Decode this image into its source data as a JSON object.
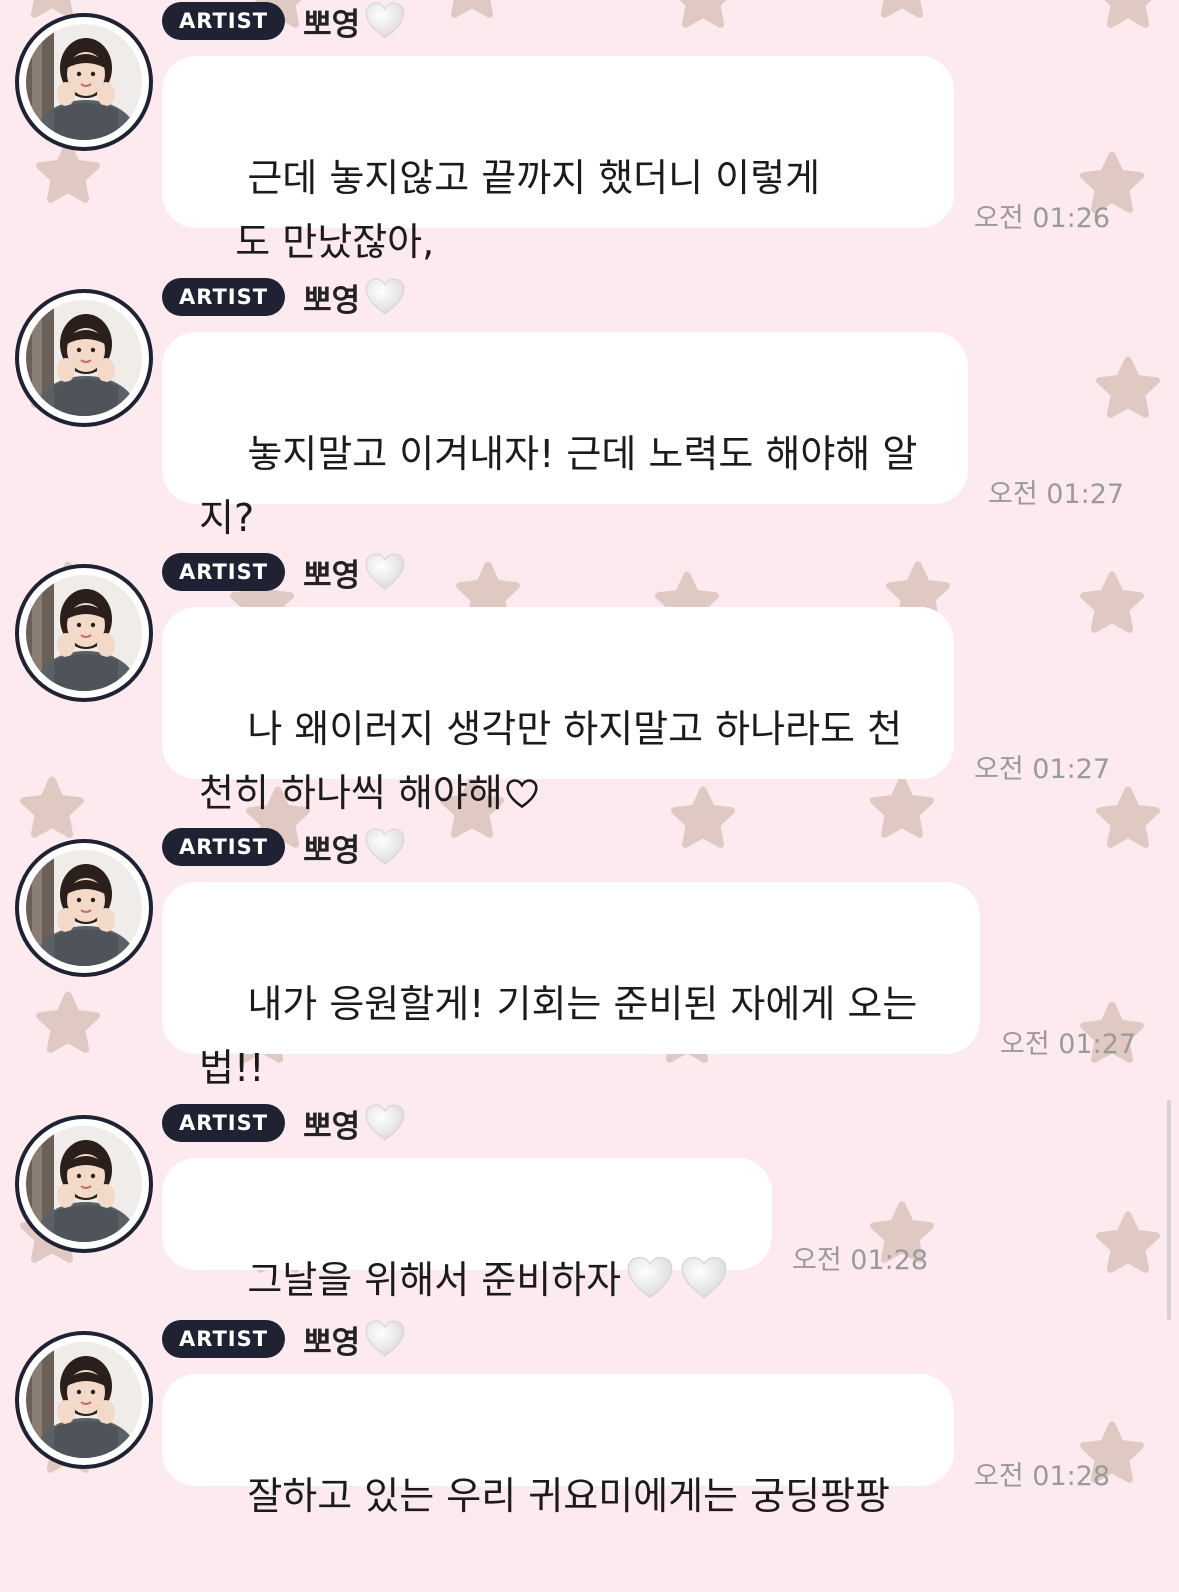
{
  "colors": {
    "background": "#fceaee",
    "star": "#dfc9c2",
    "badge": "#1f2233",
    "bubble": "#ffffff",
    "timestamp": "#9a9a9a"
  },
  "messages": [
    {
      "badge": "ARTIST",
      "sender": "뽀영",
      "sender_icon": "white-heart-icon",
      "lines": [
        "근데 놓지않고 끝까지 했더니 이렇게",
        "   도 만났잖아,"
      ],
      "time": "오전 01:26"
    },
    {
      "badge": "ARTIST",
      "sender": "뽀영",
      "sender_icon": "white-heart-icon",
      "lines": [
        "놓지말고 이겨내자! 근데 노력도 해야해 알",
        "지?"
      ],
      "time": "오전 01:27"
    },
    {
      "badge": "ARTIST",
      "sender": "뽀영",
      "sender_icon": "white-heart-icon",
      "lines": [
        "나 왜이러지 생각만 하지말고 하나라도 천",
        "천히 하나씩 해야해"
      ],
      "trailing_icon": "outline-heart-icon",
      "time": "오전 01:27"
    },
    {
      "badge": "ARTIST",
      "sender": "뽀영",
      "sender_icon": "white-heart-icon",
      "lines": [
        "내가 응원할게! 기회는 준비된 자에게 오는",
        "법!!"
      ],
      "time": "오전 01:27"
    },
    {
      "badge": "ARTIST",
      "sender": "뽀영",
      "sender_icon": "white-heart-icon",
      "lines": [
        "그날을 위해서 준비하자"
      ],
      "trailing_icon": "two-white-hearts",
      "time": "오전 01:28"
    },
    {
      "badge": "ARTIST",
      "sender": "뽀영",
      "sender_icon": "white-heart-icon",
      "lines": [
        "잘하고 있는 우리 귀요미에게는 궁딩팡팡"
      ],
      "time": "오전 01:28"
    }
  ]
}
